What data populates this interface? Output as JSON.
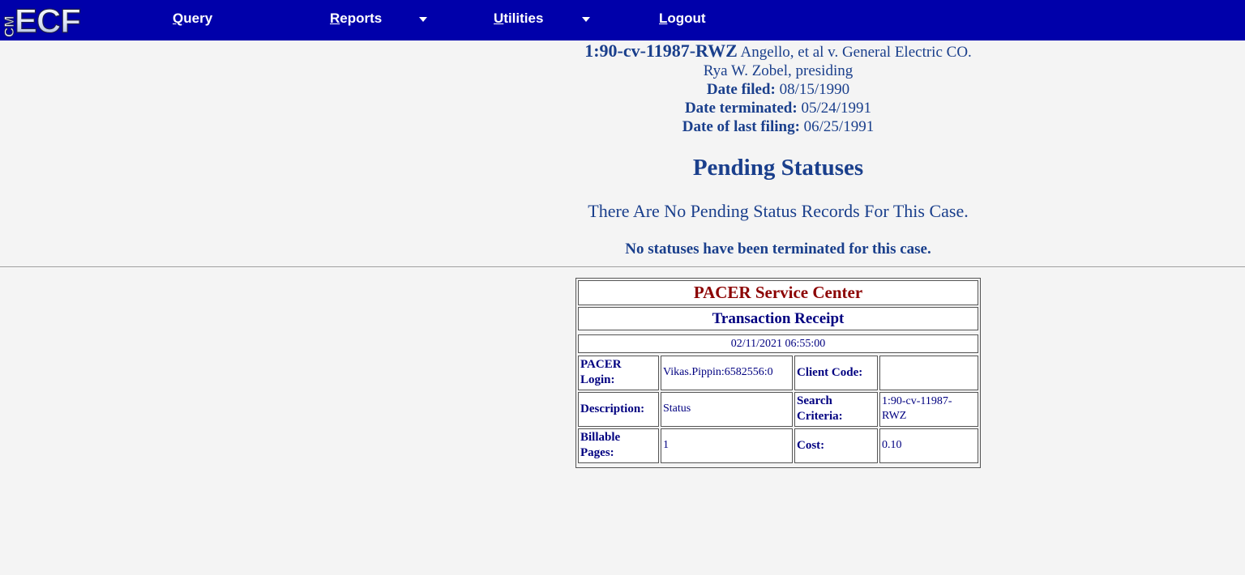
{
  "nav": {
    "logo_text": "CM/ECF",
    "items": [
      {
        "label": "Query",
        "hotkey": "Q",
        "rest": "uery",
        "has_menu": false
      },
      {
        "label": "Reports",
        "hotkey": "R",
        "rest": "eports",
        "has_menu": true
      },
      {
        "label": "Utilities",
        "hotkey": "U",
        "rest": "tilities",
        "has_menu": true
      },
      {
        "label": "Logout",
        "hotkey": "L",
        "rest": "ogout",
        "has_menu": false
      }
    ]
  },
  "case": {
    "number": "1:90-cv-11987-RWZ",
    "title": "Angello, et al v. General Electric CO.",
    "judge": "Rya W. Zobel, presiding",
    "date_filed_label": "Date filed:",
    "date_filed": "08/15/1990",
    "date_terminated_label": "Date terminated:",
    "date_terminated": "05/24/1991",
    "date_last_filing_label": "Date of last filing:",
    "date_last_filing": "06/25/1991"
  },
  "pending": {
    "heading": "Pending Statuses",
    "none_message": "There Are No Pending Status Records For This Case.",
    "terminated_message": "No statuses have been terminated for this case."
  },
  "receipt": {
    "service_center": "PACER Service Center",
    "title": "Transaction Receipt",
    "timestamp": "02/11/2021 06:55:00",
    "login_label": "PACER Login:",
    "login": "Vikas.Pippin:6582556:0",
    "client_code_label": "Client Code:",
    "client_code": "",
    "description_label": "Description:",
    "description": "Status",
    "search_label": "Search Criteria:",
    "search": "1:90-cv-11987-RWZ",
    "pages_label": "Billable Pages:",
    "pages": "1",
    "cost_label": "Cost:",
    "cost": "0.10"
  },
  "colors": {
    "navbar": "#0000aa",
    "text": "#1a3f8c",
    "service_center": "#8b0000",
    "receipt_text": "#000080",
    "background": "#f4f4f4"
  }
}
